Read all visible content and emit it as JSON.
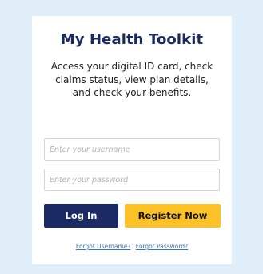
{
  "toolkit": {
    "title": "My Health Toolkit",
    "description": "Access your digital ID card, check claims status, view plan details, and check your benefits.",
    "username_placeholder": "Enter your username",
    "password_placeholder": "Enter your password",
    "login_label": "Log In",
    "register_label": "Register Now",
    "forgot_username": "Forgot Username?",
    "forgot_password": "Forgot Password?"
  },
  "colors": {
    "page_background": "#dfeef8",
    "primary_navy": "#1b2a62",
    "accent_yellow": "#fcc227",
    "link_blue": "#3a72c0"
  }
}
